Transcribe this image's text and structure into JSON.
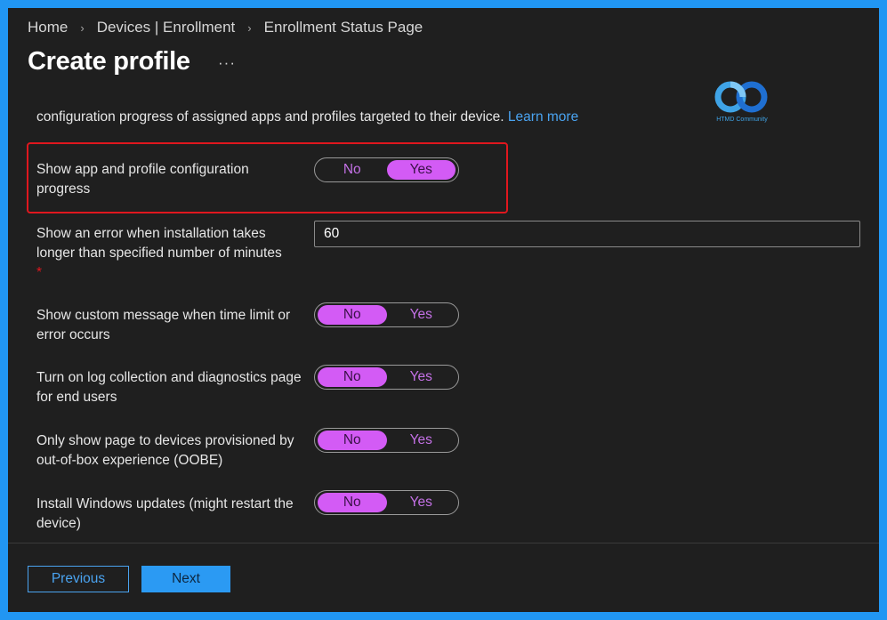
{
  "breadcrumb": {
    "items": [
      "Home",
      "Devices | Enrollment",
      "Enrollment Status Page"
    ]
  },
  "page": {
    "title": "Create profile",
    "more": "···"
  },
  "watermark": {
    "text": "HTMD Community"
  },
  "description": {
    "text": "configuration progress of assigned apps and profiles targeted to their device.",
    "link": "Learn more"
  },
  "settings": {
    "show_progress": {
      "label": "Show app and profile configuration progress",
      "no": "No",
      "yes": "Yes",
      "selected": "Yes"
    },
    "timeout": {
      "label": "Show an error when installation takes longer than specified number of minutes",
      "required": "*",
      "value": "60"
    },
    "custom_message": {
      "label": "Show custom message when time limit or error occurs",
      "no": "No",
      "yes": "Yes",
      "selected": "No"
    },
    "log_collection": {
      "label": "Turn on log collection and diagnostics page for end users",
      "no": "No",
      "yes": "Yes",
      "selected": "No"
    },
    "oobe_only": {
      "label": "Only show page to devices provisioned by out-of-box experience (OOBE)",
      "no": "No",
      "yes": "Yes",
      "selected": "No"
    },
    "windows_updates": {
      "label": "Install Windows updates (might restart the device)",
      "no": "No",
      "yes": "Yes",
      "selected": "No"
    }
  },
  "footer": {
    "previous": "Previous",
    "next": "Next"
  },
  "colors": {
    "frame_border": "#2196f3",
    "background": "#1f1f1f",
    "toggle_selected": "#d35bf5",
    "link": "#4aa3f0",
    "highlight": "#e0171e"
  }
}
